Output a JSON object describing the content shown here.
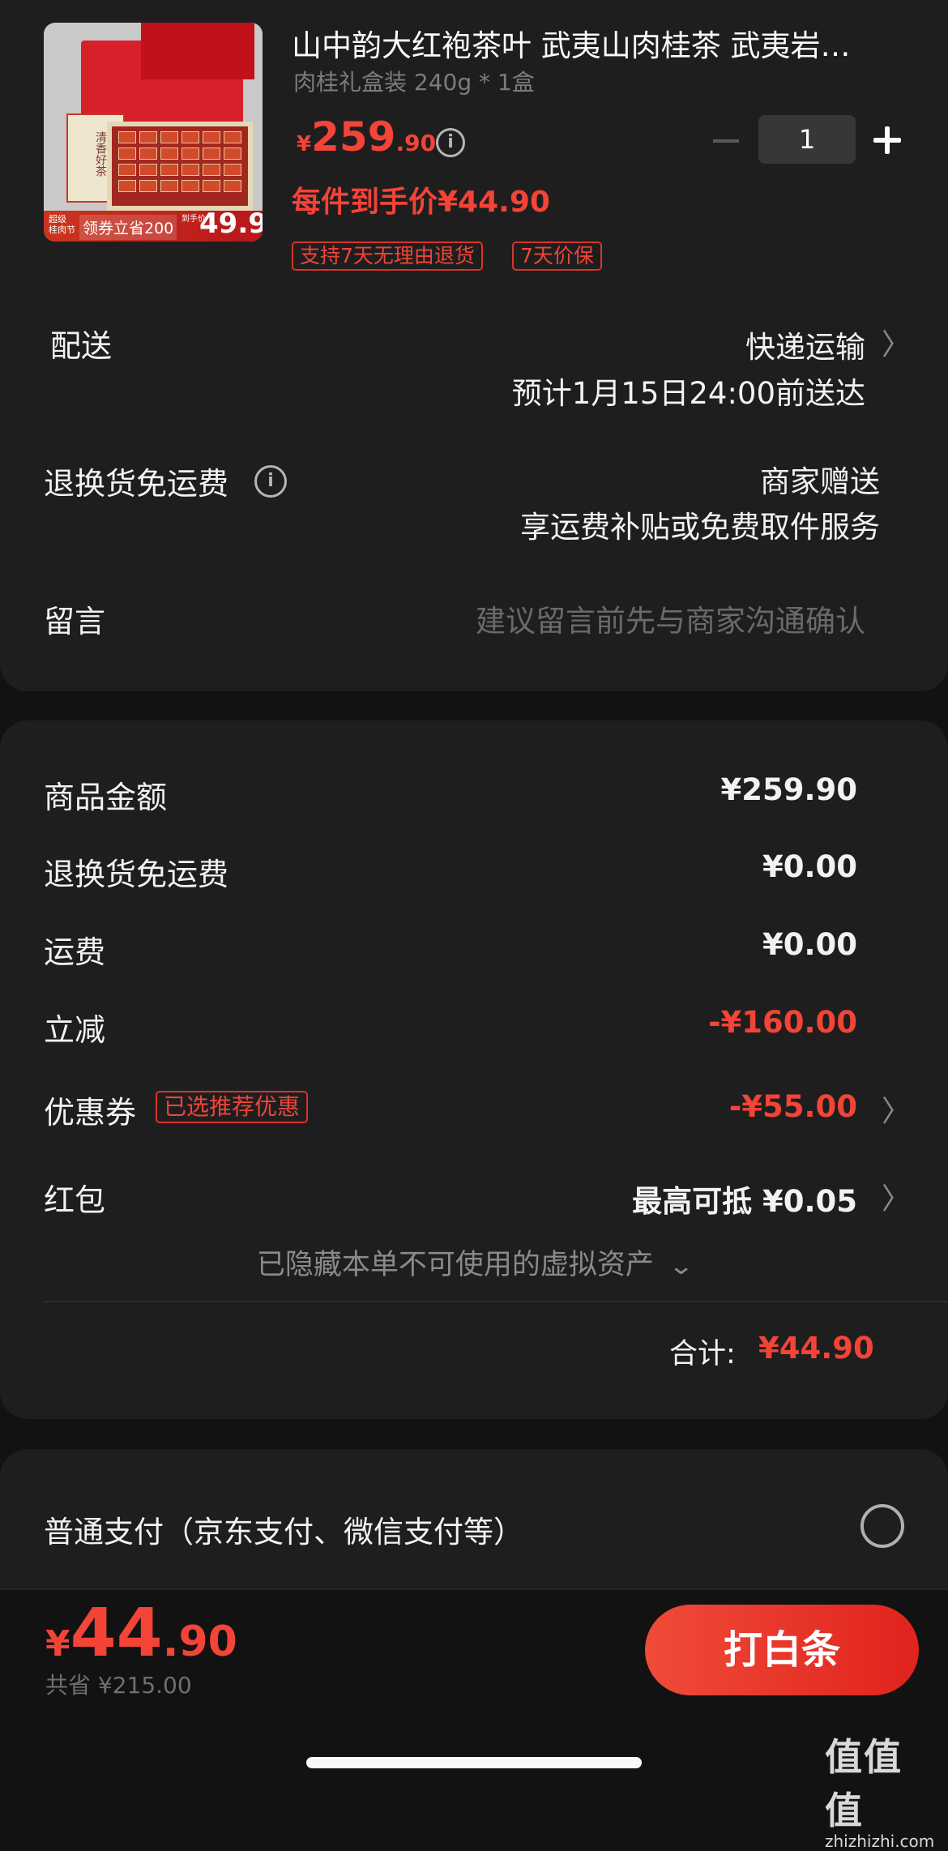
{
  "product": {
    "title": "山中韵大红袍茶叶 武夷山肉桂茶 武夷岩…",
    "spec": "肉桂礼盒装 240g * 1盒",
    "price_currency": "¥",
    "price_int": "259",
    "price_dec": ".90",
    "unit_price_label": "每件到手价¥44.90",
    "tags": [
      "支持7天无理由退货",
      "7天价保"
    ],
    "quantity": "1",
    "thumb_text": {
      "box_text": "清香好茶",
      "badge_small": "超级 桂肉节",
      "coupon_text": "领券立省200",
      "price_label": "到手价",
      "price_value": "49.9"
    }
  },
  "delivery": {
    "label": "配送",
    "method": "快递运输",
    "eta": "预计1月15日24:00前送达"
  },
  "return_shipping": {
    "label": "退换货免运费",
    "value": "商家赠送",
    "desc": "享运费补贴或免费取件服务"
  },
  "message": {
    "label": "留言",
    "placeholder": "建议留言前先与商家沟通确认"
  },
  "summary": {
    "rows": [
      {
        "label": "商品金额",
        "value": "¥259.90"
      },
      {
        "label": "退换货免运费",
        "value": "¥0.00"
      },
      {
        "label": "运费",
        "value": "¥0.00"
      },
      {
        "label": "立减",
        "value": "-¥160.00"
      }
    ],
    "coupon": {
      "label": "优惠券",
      "badge": "已选推荐优惠",
      "value": "-¥55.00"
    },
    "redpacket": {
      "label": "红包",
      "value": "最高可抵 ¥0.05"
    },
    "hidden_note": "已隐藏本单不可使用的虚拟资产",
    "total_label": "合计:",
    "total_value": "¥44.90"
  },
  "payment": {
    "option_label": "普通支付（京东支付、微信支付等）"
  },
  "footer": {
    "currency": "¥",
    "total_int": "44",
    "total_dec": ".90",
    "saved": "共省 ¥215.00",
    "pay_button": "打白条"
  },
  "watermark": {
    "title": "值值值",
    "domain": "zhizhizhi.com"
  },
  "colors": {
    "accent": "#f44337",
    "card": "#1f1e1f",
    "background": "#121212"
  },
  "icons": [
    "info-icon",
    "chevron-right-icon",
    "chevron-down-icon",
    "minus-icon",
    "plus-icon",
    "radio-icon"
  ]
}
